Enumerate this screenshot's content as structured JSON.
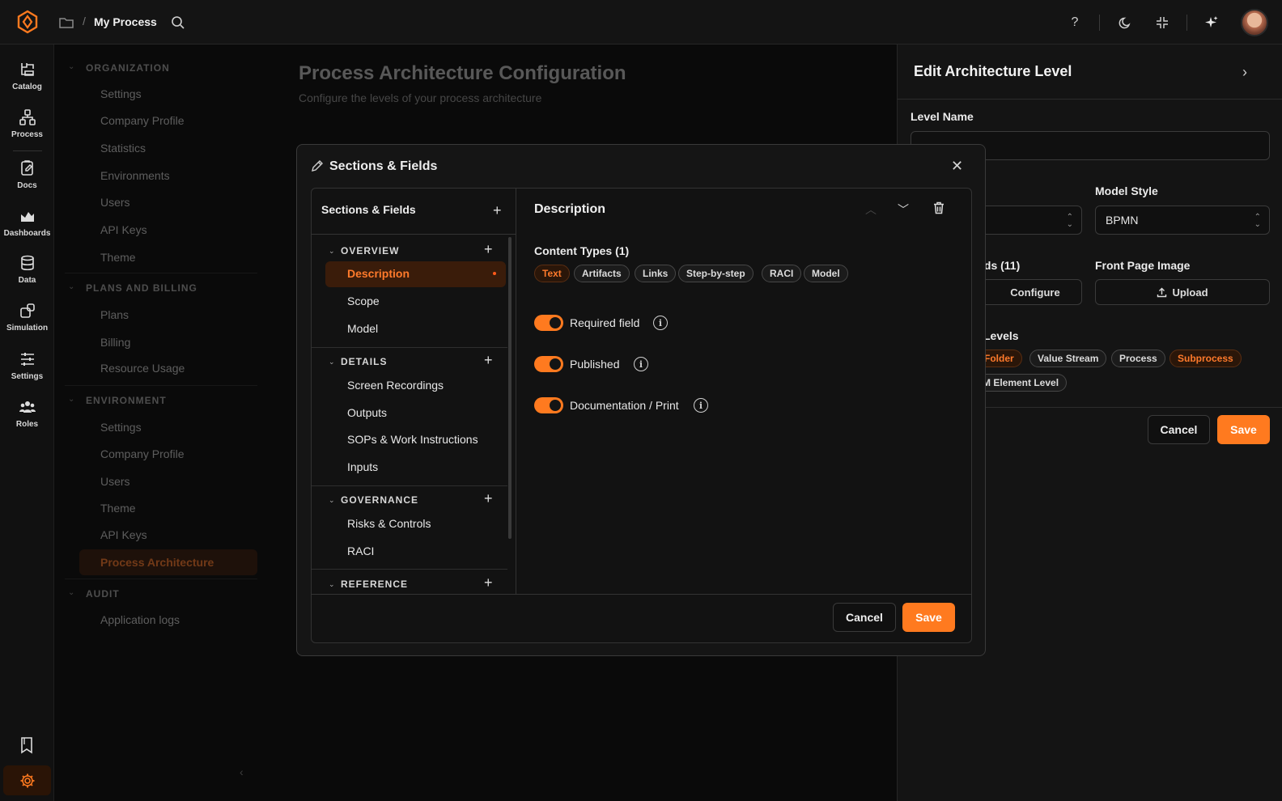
{
  "header": {
    "title": "My Process",
    "help": "?"
  },
  "rail": [
    {
      "label": "Catalog",
      "icon": "catalog-icon"
    },
    {
      "label": "Process",
      "icon": "process-icon"
    },
    {
      "label": "Docs",
      "icon": "docs-icon"
    },
    {
      "label": "Dashboards",
      "icon": "dashboards-icon"
    },
    {
      "label": "Data",
      "icon": "data-icon"
    },
    {
      "label": "Simulation",
      "icon": "simulation-icon"
    },
    {
      "label": "Settings",
      "icon": "settings-sliders-icon"
    },
    {
      "label": "Roles",
      "icon": "roles-icon"
    }
  ],
  "nav": {
    "organization": {
      "title": "ORGANIZATION",
      "items": [
        "Settings",
        "Company Profile",
        "Statistics",
        "Environments",
        "Users",
        "API Keys",
        "Theme"
      ]
    },
    "plans": {
      "title": "PLANS AND BILLING",
      "items": [
        "Plans",
        "Billing",
        "Resource Usage"
      ]
    },
    "environment": {
      "title": "ENVIRONMENT",
      "items": [
        "Settings",
        "Company Profile",
        "Users",
        "Theme",
        "API Keys",
        "Process Architecture"
      ]
    },
    "audit": {
      "title": "AUDIT",
      "items": [
        "Application logs"
      ]
    }
  },
  "main": {
    "title": "Process Architecture Configuration",
    "subtitle": "Configure the levels of your process architecture"
  },
  "panel": {
    "title": "Edit Architecture Level",
    "level_name_label": "Level Name",
    "model_style_label": "Model Style",
    "model_style_value": "BPMN",
    "fields_label": "lds (11)",
    "configure_label": "Configure",
    "front_page_label": "Front Page Image",
    "upload_label": "Upload",
    "levels_label": "Levels",
    "levels": [
      "Folder",
      "Value Stream",
      "Process",
      "Subprocess",
      "M Element Level"
    ],
    "cancel": "Cancel",
    "save": "Save"
  },
  "modal": {
    "title": "Sections & Fields",
    "list_title": "Sections & Fields",
    "sections": [
      {
        "name": "OVERVIEW",
        "fields": [
          "Description",
          "Scope",
          "Model"
        ]
      },
      {
        "name": "DETAILS",
        "fields": [
          "Screen Recordings",
          "Outputs",
          "SOPs & Work Instructions",
          "Inputs"
        ]
      },
      {
        "name": "GOVERNANCE",
        "fields": [
          "Risks & Controls",
          "RACI"
        ]
      },
      {
        "name": "REFERENCE",
        "fields": []
      }
    ],
    "detail": {
      "title": "Description",
      "content_types_label": "Content Types (1)",
      "content_types": [
        "Text",
        "Artifacts",
        "Links",
        "Step-by-step",
        "RACI",
        "Model"
      ],
      "toggles": [
        "Required field",
        "Published",
        "Documentation / Print"
      ]
    },
    "cancel": "Cancel",
    "save": "Save"
  },
  "colors": {
    "accent": "#ff7a1f",
    "background": "#0a0a0a"
  }
}
